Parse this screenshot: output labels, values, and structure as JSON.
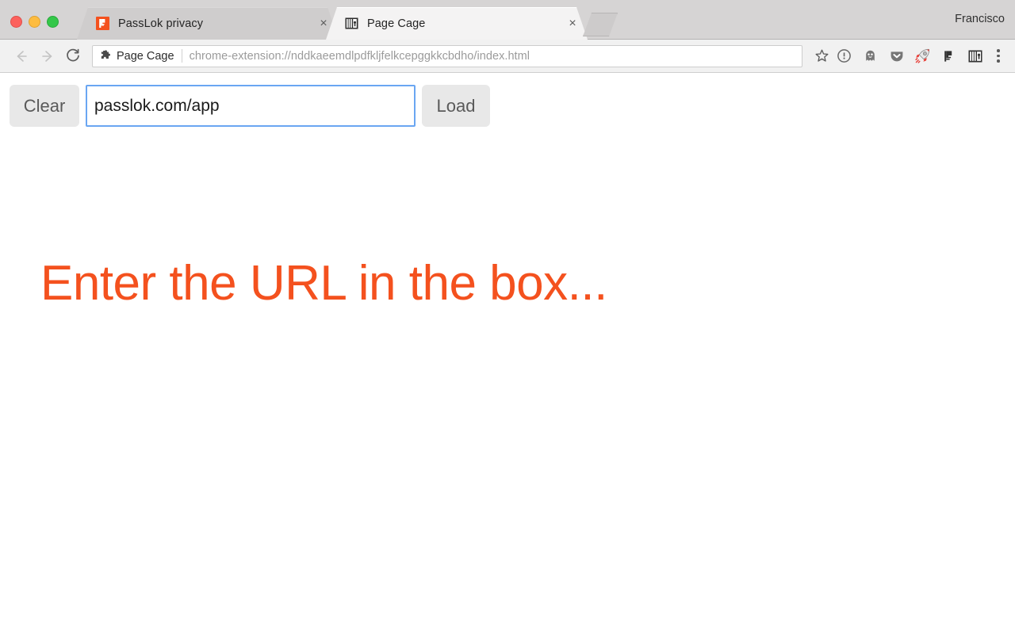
{
  "window": {
    "profile_name": "Francisco",
    "traffic_lights": [
      "close",
      "minimize",
      "maximize"
    ]
  },
  "tabs": [
    {
      "title": "PassLok privacy",
      "favicon": "passlok-icon",
      "active": false,
      "close_label": "×"
    },
    {
      "title": "Page Cage",
      "favicon": "page-cage-icon",
      "active": true,
      "close_label": "×"
    }
  ],
  "newtab": {
    "label": ""
  },
  "toolbar": {
    "back": "back-arrow-icon",
    "forward": "forward-arrow-icon",
    "reload": "reload-icon",
    "omnibox": {
      "extension_icon": "puzzle-piece-icon",
      "extension_name": "Page Cage",
      "url": "chrome-extension://nddkaeemdlpdfkljfelkcepggkkcbdho/index.html",
      "bookmark_icon": "star-icon"
    },
    "extensions": [
      {
        "name": "info-circle-icon"
      },
      {
        "name": "ghost-icon"
      },
      {
        "name": "pocket-icon"
      },
      {
        "name": "rocket-icon"
      },
      {
        "name": "passlok-p-icon"
      },
      {
        "name": "page-cage-bars-icon"
      }
    ],
    "menu": "three-dot-menu-icon"
  },
  "page": {
    "clear_label": "Clear",
    "load_label": "Load",
    "url_value": "passlok.com/app",
    "url_placeholder": "",
    "headline": "Enter the URL in the box...",
    "colors": {
      "headline": "#f4511e",
      "input_focus_border": "#6aa6f2",
      "button_bg": "#e8e8e8",
      "passlok_orange": "#f4511e"
    }
  }
}
